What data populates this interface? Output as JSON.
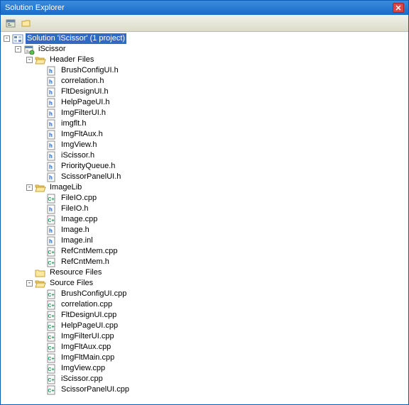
{
  "title": "Solution Explorer",
  "solution": {
    "label": "Solution 'iScissor' (1 project)",
    "project": {
      "label": "iScissor",
      "folders": [
        {
          "name": "Header Files",
          "expanded": true,
          "items": [
            {
              "label": "BrushConfigUI.h",
              "type": "h"
            },
            {
              "label": "correlation.h",
              "type": "h"
            },
            {
              "label": "FltDesignUI.h",
              "type": "h"
            },
            {
              "label": "HelpPageUI.h",
              "type": "h"
            },
            {
              "label": "ImgFilterUI.h",
              "type": "h"
            },
            {
              "label": "imgflt.h",
              "type": "h"
            },
            {
              "label": "ImgFltAux.h",
              "type": "h"
            },
            {
              "label": "ImgView.h",
              "type": "h"
            },
            {
              "label": "iScissor.h",
              "type": "h"
            },
            {
              "label": "PriorityQueue.h",
              "type": "h"
            },
            {
              "label": "ScissorPanelUI.h",
              "type": "h"
            }
          ]
        },
        {
          "name": "ImageLib",
          "expanded": true,
          "items": [
            {
              "label": "FileIO.cpp",
              "type": "cpp"
            },
            {
              "label": "FileIO.h",
              "type": "h"
            },
            {
              "label": "Image.cpp",
              "type": "cpp"
            },
            {
              "label": "Image.h",
              "type": "h"
            },
            {
              "label": "Image.inl",
              "type": "h"
            },
            {
              "label": "RefCntMem.cpp",
              "type": "cpp"
            },
            {
              "label": "RefCntMem.h",
              "type": "cpp"
            }
          ]
        },
        {
          "name": "Resource Files",
          "expanded": false,
          "items": []
        },
        {
          "name": "Source Files",
          "expanded": true,
          "items": [
            {
              "label": "BrushConfigUI.cpp",
              "type": "cpp"
            },
            {
              "label": "correlation.cpp",
              "type": "cpp"
            },
            {
              "label": "FltDesignUI.cpp",
              "type": "cpp"
            },
            {
              "label": "HelpPageUI.cpp",
              "type": "cpp"
            },
            {
              "label": "ImgFilterUI.cpp",
              "type": "cpp"
            },
            {
              "label": "ImgFltAux.cpp",
              "type": "cpp"
            },
            {
              "label": "ImgFltMain.cpp",
              "type": "cpp"
            },
            {
              "label": "ImgView.cpp",
              "type": "cpp"
            },
            {
              "label": "iScissor.cpp",
              "type": "cpp"
            },
            {
              "label": "ScissorPanelUI.cpp",
              "type": "cpp"
            }
          ]
        }
      ]
    }
  }
}
